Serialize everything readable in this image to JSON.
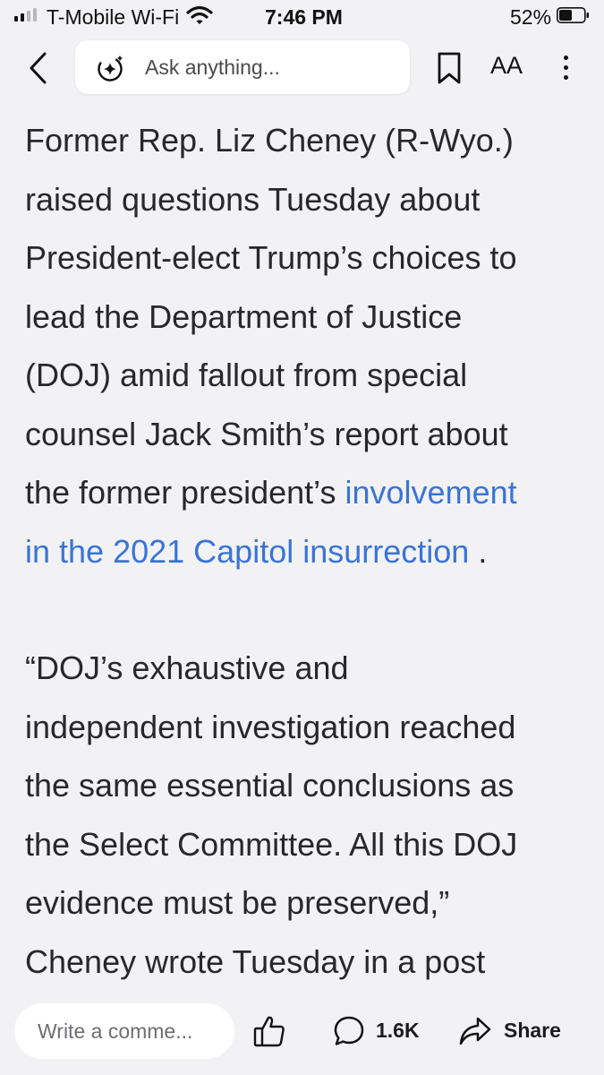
{
  "status_bar": {
    "carrier": "T-Mobile Wi-Fi",
    "time": "7:46 PM",
    "battery_percent": "52%",
    "battery_level": 0.52,
    "signal_bars": 2
  },
  "nav": {
    "back_icon": "chevron-left-icon",
    "ask_icon": "sparkle-icon",
    "ask_placeholder": "Ask anything...",
    "bookmark_icon": "bookmark-icon",
    "text_size_label": "AA",
    "more_icon": "more-vertical-icon"
  },
  "article": {
    "paragraph1_lines": [
      "Former Rep. Liz Cheney (R-Wyo.)",
      "raised questions Tuesday about",
      "President-elect Trump’s choices to",
      "lead the Department of Justice",
      "(DOJ) amid fallout from special",
      "counsel Jack Smith’s report about"
    ],
    "paragraph1_last_prefix": "the former president’s ",
    "link_line1": "involvement",
    "link_line2": "in the 2021 Capitol insurrection",
    "paragraph1_suffix": " .",
    "paragraph2_lines": [
      "“DOJ’s exhaustive and",
      "independent investigation reached",
      "the same essential conclusions as",
      "the Select Committee. All this DOJ",
      "evidence must be preserved,”",
      "Cheney wrote Tuesday in a post"
    ]
  },
  "bottom_bar": {
    "comment_placeholder": "Write a comme...",
    "like_icon": "thumbs-up-icon",
    "comment_icon": "comment-bubble-icon",
    "comment_count": "1.6K",
    "share_icon": "share-arrow-icon",
    "share_label": "Share"
  },
  "colors": {
    "background": "#f2f2f4",
    "link": "#3a74d6",
    "text": "#28282a"
  }
}
